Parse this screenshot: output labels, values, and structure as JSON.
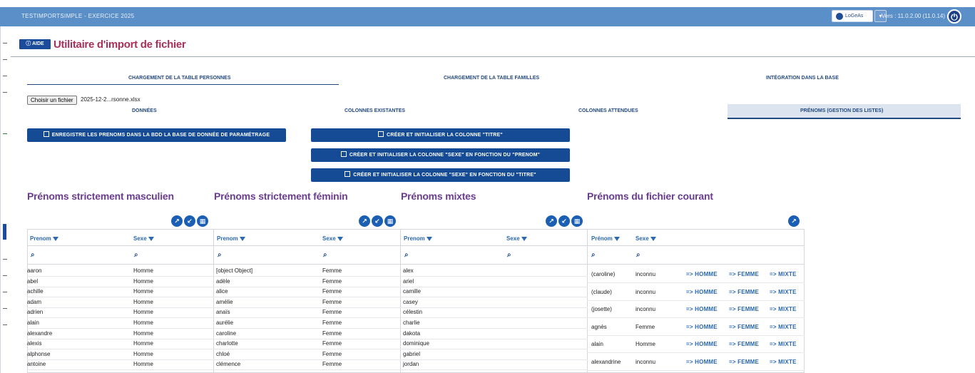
{
  "app": {
    "title": "TESTIMPORTSIMPLE - EXERCICE 2025",
    "user_button": "LoGeAs",
    "caret": "▾",
    "version": "Vers : 11.0.2.00 (11.0.14)",
    "power_icon": "power-icon"
  },
  "header": {
    "aide_label": "AIDE",
    "page_title": "Utilitaire d'import de fichier"
  },
  "tabs": [
    {
      "label": "CHARGEMENT DE LA TABLE PERSONNES",
      "active": true
    },
    {
      "label": "CHARGEMENT DE LA TABLE FAMILLES",
      "active": false
    },
    {
      "label": "INTÉGRATION DANS LA BASE",
      "active": false
    }
  ],
  "file": {
    "button_label": "Choisir un fichier",
    "file_name": "2025-12-2...rsonne.xlsx"
  },
  "subtabs": [
    {
      "label": "DONNÉES",
      "active": false
    },
    {
      "label": "COLONNES EXISTANTES",
      "active": false
    },
    {
      "label": "COLONNES ATTENDUES",
      "active": false
    },
    {
      "label": "PRÉNOMS (GESTION DES LISTES)",
      "active": true
    }
  ],
  "actions": {
    "save_prenoms": "ENREGISTRE LES PRENOMS DANS LA BDD LA BASE DE DONNÉE DE PARAMÉTRAGE",
    "create_titre": "CRÉER ET INITIALISER LA COLONNE \"TITRE\"",
    "create_sexe_prenom": "CRÉER ET INITIALISER LA COLONNE \"SEXE\" EN FONCTION DU \"PRENOM\"",
    "create_sexe_titre": "CRÉER ET INITIALISER LA COLONNE \"SEXE\" EN FONCTION DU \"TITRE\""
  },
  "lists": {
    "masculin": {
      "title": "Prénoms strictement masculien",
      "col_prenom": "Prenom",
      "col_sexe": "Sexe",
      "rows": [
        [
          "aaron",
          "Homme"
        ],
        [
          "abel",
          "Homme"
        ],
        [
          "achille",
          "Homme"
        ],
        [
          "adam",
          "Homme"
        ],
        [
          "adrien",
          "Homme"
        ],
        [
          "alain",
          "Homme"
        ],
        [
          "alexandre",
          "Homme"
        ],
        [
          "alexis",
          "Homme"
        ],
        [
          "alphonse",
          "Homme"
        ],
        [
          "antoine",
          "Homme"
        ]
      ]
    },
    "feminin": {
      "title": "Prénoms strictement féminin",
      "col_prenom": "Prenom",
      "col_sexe": "Sexe",
      "rows": [
        [
          "[object Object]",
          "Femme"
        ],
        [
          "adèle",
          "Femme"
        ],
        [
          "alice",
          "Femme"
        ],
        [
          "amélie",
          "Femme"
        ],
        [
          "anaïs",
          "Femme"
        ],
        [
          "aurélie",
          "Femme"
        ],
        [
          "caroline",
          "Femme"
        ],
        [
          "charlotte",
          "Femme"
        ],
        [
          "chloé",
          "Femme"
        ],
        [
          "clémence",
          "Femme"
        ]
      ]
    },
    "mixtes": {
      "title": "Prénoms mixtes",
      "col_prenom": "Prenom",
      "col_sexe": "Sexe",
      "rows": [
        [
          "alex",
          ""
        ],
        [
          "ariel",
          ""
        ],
        [
          "camille",
          ""
        ],
        [
          "casey",
          ""
        ],
        [
          "célestin",
          ""
        ],
        [
          "charlie",
          ""
        ],
        [
          "dakota",
          ""
        ],
        [
          "dominique",
          ""
        ],
        [
          "gabriel",
          ""
        ],
        [
          "jordan",
          ""
        ]
      ]
    },
    "courant": {
      "title": "Prénoms du fichier courant",
      "col_prenom": "Prénom",
      "col_sexe": "Sexe",
      "link_homme": "=> HOMME",
      "link_femme": "=> FEMME",
      "link_mixte": "=> MIXTE",
      "rows": [
        [
          "(caroline)",
          "inconnu"
        ],
        [
          "(claude)",
          "inconnu"
        ],
        [
          "(josette)",
          "inconnu"
        ],
        [
          "agnès",
          "Femme"
        ],
        [
          "alain",
          "Homme"
        ],
        [
          "alexandrine",
          "inconnu"
        ]
      ]
    }
  },
  "icons": {
    "export": "export-icon",
    "import": "import-icon",
    "table": "table-icon",
    "search": "search-icon",
    "filter": "filter-icon"
  },
  "colors": {
    "topbar": "#5b8fc7",
    "primary": "#154b94",
    "title": "#a8305a",
    "section": "#6a3d8f",
    "link": "#2a68b0"
  }
}
